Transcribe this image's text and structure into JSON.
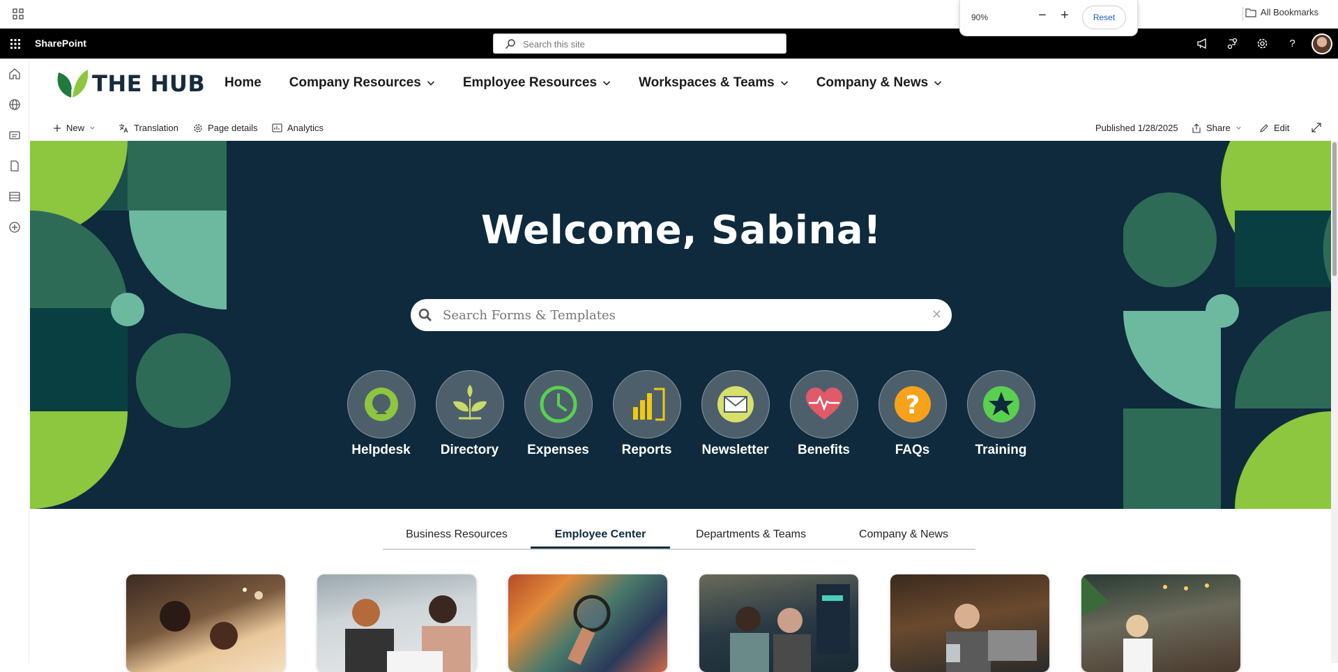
{
  "browser": {
    "bookmarks_label": "All Bookmarks",
    "zoom": {
      "level": "90%",
      "minus": "−",
      "plus": "+",
      "reset": "Reset"
    }
  },
  "suite": {
    "app_name": "SharePoint",
    "search_placeholder": "Search this site",
    "icons": [
      "megaphone-icon",
      "share-network-icon",
      "gear-icon",
      "help-icon",
      "avatar"
    ],
    "help_glyph": "?"
  },
  "rail": {
    "icons": [
      "home-icon",
      "globe-icon",
      "news-icon",
      "document-icon",
      "list-icon",
      "add-circle-icon"
    ]
  },
  "site": {
    "logo_text": "THE HUB",
    "nav": [
      {
        "label": "Home",
        "has_menu": false
      },
      {
        "label": "Company Resources",
        "has_menu": true
      },
      {
        "label": "Employee Resources",
        "has_menu": true
      },
      {
        "label": "Workspaces & Teams",
        "has_menu": true
      },
      {
        "label": "Company & News",
        "has_menu": true
      }
    ]
  },
  "command_bar": {
    "new": "New",
    "translation": "Translation",
    "page_details": "Page details",
    "analytics": "Analytics",
    "published": "Published 1/28/2025",
    "share": "Share",
    "edit": "Edit"
  },
  "hero": {
    "title": "Welcome, Sabina!",
    "search_placeholder": "Search Forms & Templates",
    "clear_glyph": "✕",
    "quick_links": [
      {
        "label": "Helpdesk",
        "icon": "helpdesk-icon"
      },
      {
        "label": "Directory",
        "icon": "leaf-icon"
      },
      {
        "label": "Expenses",
        "icon": "clock-icon"
      },
      {
        "label": "Reports",
        "icon": "powerbi-icon"
      },
      {
        "label": "Newsletter",
        "icon": "mail-icon"
      },
      {
        "label": "Benefits",
        "icon": "heart-pulse-icon"
      },
      {
        "label": "FAQs",
        "icon": "question-icon"
      },
      {
        "label": "Training",
        "icon": "star-icon"
      }
    ]
  },
  "tabs": [
    {
      "label": "Business Resources",
      "active": false
    },
    {
      "label": "Employee Center",
      "active": true
    },
    {
      "label": "Departments & Teams",
      "active": false
    },
    {
      "label": "Company & News",
      "active": false
    }
  ],
  "colors": {
    "hero_bg": "#0e2a3c",
    "accent_green": "#8dc63f",
    "mid_green": "#2e6b57",
    "mint": "#6db9a0",
    "dark_teal": "#0a3f42"
  }
}
